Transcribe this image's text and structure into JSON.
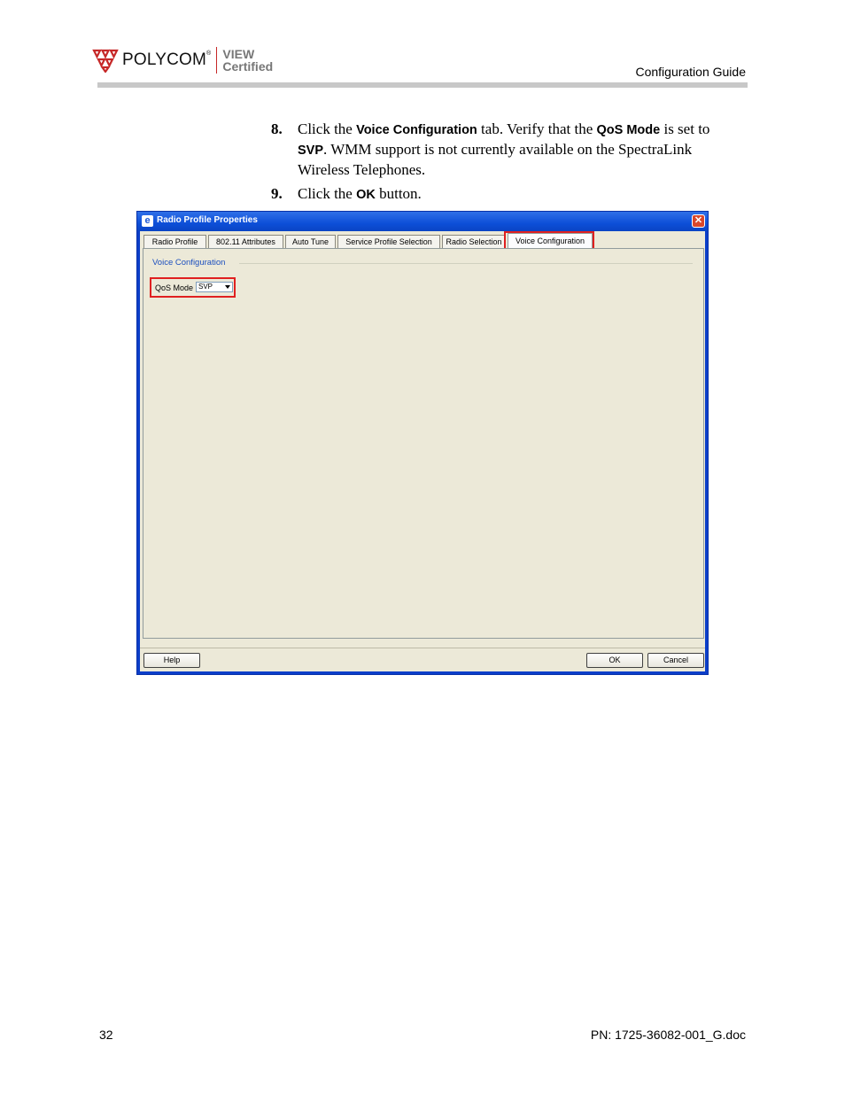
{
  "header": {
    "brand": "POLYCOM",
    "brand_mark": "®",
    "cert_line1": "VIEW",
    "cert_line2": "Certified",
    "doc_title": "Configuration Guide"
  },
  "steps": [
    {
      "number": "8.",
      "parts": [
        "Click the ",
        "Voice Configuration",
        " tab. Verify that the ",
        "QoS Mode",
        " is set to ",
        "SVP",
        ". WMM support is not currently available on the SpectraLink Wireless Telephones."
      ]
    },
    {
      "number": "9.",
      "parts": [
        "Click the ",
        "OK",
        " button."
      ]
    }
  ],
  "dialog": {
    "title": "Radio Profile Properties",
    "close_glyph": "✕",
    "tabs": [
      "Radio Profile",
      "802.11 Attributes",
      "Auto Tune",
      "Service Profile Selection",
      "Radio Selection",
      "Voice Configuration"
    ],
    "selected_tab": "Voice Configuration",
    "group_title": "Voice Configuration",
    "qos_label": "QoS Mode",
    "qos_value": "SVP",
    "buttons": {
      "help": "Help",
      "ok": "OK",
      "cancel": "Cancel"
    }
  },
  "colors": {
    "highlight": "#e02020",
    "titlebar": "#0d4fd8",
    "group_title": "#1c4fbf",
    "logo_red": "#c62828"
  },
  "icons": [
    "polycom-logo-icon",
    "dialog-app-icon",
    "close-icon",
    "dropdown-arrow-icon"
  ],
  "footer": {
    "page_number": "32",
    "doc_number": "PN: 1725-36082-001_G.doc"
  }
}
